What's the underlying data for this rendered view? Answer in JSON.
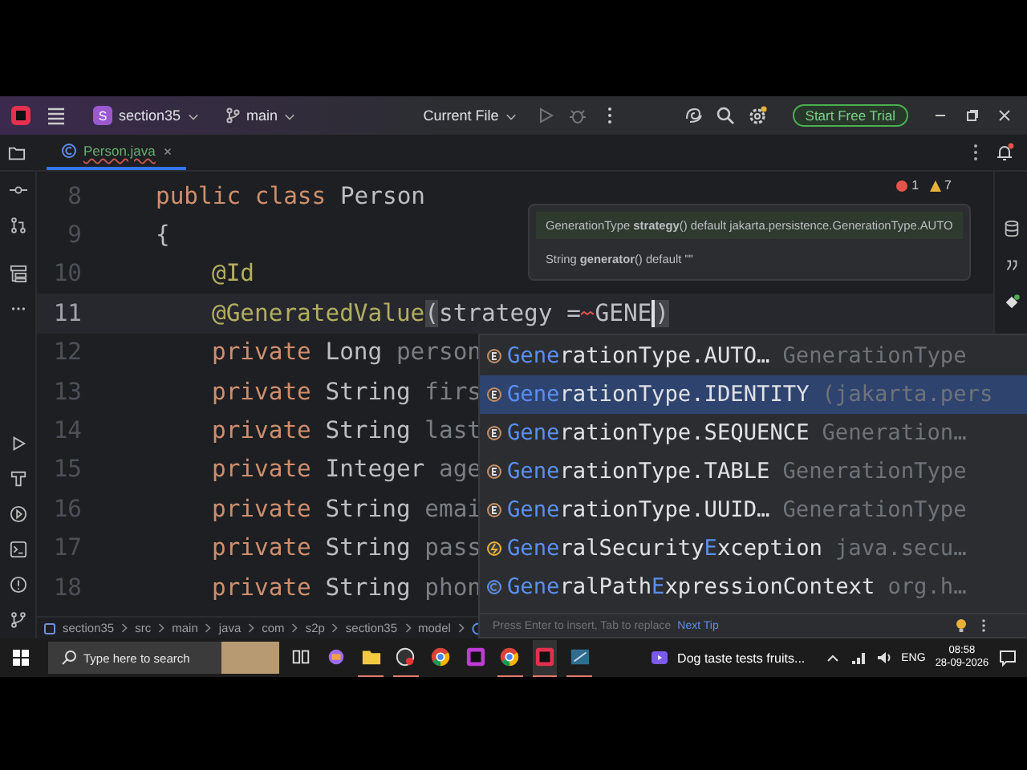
{
  "title_bar": {
    "project_initial": "S",
    "project": "section35",
    "branch": "main",
    "run_config": "Current File",
    "trial_button": "Start Free Trial"
  },
  "tabs": [
    {
      "label": "Person.java",
      "selected": true
    }
  ],
  "code_lines": [
    {
      "number": "8",
      "indented": false,
      "current": false,
      "tokens": [
        {
          "text": "public class",
          "kind": "keyword"
        },
        {
          "text": " Person",
          "kind": "plain"
        }
      ]
    },
    {
      "number": "9",
      "indented": false,
      "current": false,
      "tokens": [
        {
          "text": "{",
          "kind": "plain"
        }
      ]
    },
    {
      "number": "10",
      "indented": true,
      "current": false,
      "tokens": [
        {
          "text": "@Id",
          "kind": "annotation"
        }
      ]
    },
    {
      "number": "11",
      "indented": true,
      "current": true,
      "tokens": [
        {
          "text": "@GeneratedValue",
          "kind": "annotation"
        },
        {
          "text": "(",
          "kind": "bracket"
        },
        {
          "text": "strategy = ",
          "kind": "plain"
        },
        {
          "text": "GENE",
          "kind": "plain",
          "error": true
        },
        {
          "text": ")",
          "kind": "bracket",
          "caret": true
        }
      ]
    },
    {
      "number": "12",
      "indented": true,
      "current": false,
      "tokens": [
        {
          "text": "private",
          "kind": "keyword"
        },
        {
          "text": " Long ",
          "kind": "plain"
        },
        {
          "text": "person",
          "kind": "unused"
        }
      ]
    },
    {
      "number": "13",
      "indented": true,
      "current": false,
      "tokens": [
        {
          "text": "private",
          "kind": "keyword"
        },
        {
          "text": " String ",
          "kind": "plain"
        },
        {
          "text": "firs",
          "kind": "unused"
        }
      ]
    },
    {
      "number": "14",
      "indented": true,
      "current": false,
      "tokens": [
        {
          "text": "private",
          "kind": "keyword"
        },
        {
          "text": " String ",
          "kind": "plain"
        },
        {
          "text": "last",
          "kind": "unused"
        }
      ]
    },
    {
      "number": "15",
      "indented": true,
      "current": false,
      "tokens": [
        {
          "text": "private",
          "kind": "keyword"
        },
        {
          "text": " Integer ",
          "kind": "plain"
        },
        {
          "text": "age",
          "kind": "unused"
        }
      ]
    },
    {
      "number": "16",
      "indented": true,
      "current": false,
      "tokens": [
        {
          "text": "private",
          "kind": "keyword"
        },
        {
          "text": " String ",
          "kind": "plain"
        },
        {
          "text": "emai",
          "kind": "unused"
        }
      ]
    },
    {
      "number": "17",
      "indented": true,
      "current": false,
      "tokens": [
        {
          "text": "private",
          "kind": "keyword"
        },
        {
          "text": " String ",
          "kind": "plain"
        },
        {
          "text": "pass",
          "kind": "unused"
        }
      ]
    },
    {
      "number": "18",
      "indented": true,
      "current": false,
      "tokens": [
        {
          "text": "private",
          "kind": "keyword"
        },
        {
          "text": " String ",
          "kind": "plain"
        },
        {
          "text": "phon",
          "kind": "unused"
        }
      ]
    }
  ],
  "inspections": {
    "errors": "1",
    "warnings": "7"
  },
  "parameter_info": [
    {
      "text": "GenerationType **strategy**() default jakarta.persistence.GenerationType.AUTO",
      "selected": true
    },
    {
      "text": "String **generator**() default \"\"",
      "selected": false
    }
  ],
  "completion": {
    "items": [
      {
        "kind": "enum",
        "selected": false,
        "name": "**Gene**rationType.AUTO…",
        "detail": "GenerationType"
      },
      {
        "kind": "enum",
        "selected": true,
        "name": "**Gene**rationType.IDENTITY",
        "detail": "(jakarta.pers"
      },
      {
        "kind": "enum",
        "selected": false,
        "name": "**Gene**rationType.SEQUENCE",
        "detail": "Generation…"
      },
      {
        "kind": "enum",
        "selected": false,
        "name": "**Gene**rationType.TABLE",
        "detail": "GenerationType"
      },
      {
        "kind": "enum",
        "selected": false,
        "name": "**Gene**rationType.UUID…",
        "detail": "GenerationType"
      },
      {
        "kind": "exception",
        "selected": false,
        "name": "**Gene**ralSecurity**E**xception",
        "detail": "java.secu…"
      },
      {
        "kind": "class",
        "selected": false,
        "name": "**Gene**ralPath**E**xpressionContext",
        "detail": "org.h…"
      }
    ],
    "hint": "Press Enter to insert, Tab to replace",
    "hint_link": "Next Tip"
  },
  "breadcrumbs": [
    "section35",
    "src",
    "main",
    "java",
    "com",
    "s2p",
    "section35",
    "model"
  ],
  "taskbar": {
    "search_placeholder": "Type here to search",
    "apps": [
      {
        "running": false,
        "selected": false
      },
      {
        "running": false,
        "selected": false
      },
      {
        "running": true,
        "selected": false
      },
      {
        "running": true,
        "selected": false
      },
      {
        "running": false,
        "selected": false
      },
      {
        "running": false,
        "selected": false
      },
      {
        "running": true,
        "selected": false
      },
      {
        "running": true,
        "selected": true
      },
      {
        "running": true,
        "selected": false
      }
    ],
    "media_title": "Dog taste tests fruits...",
    "language": "ENG",
    "time": "08:58",
    "date": "28-09-2026"
  }
}
